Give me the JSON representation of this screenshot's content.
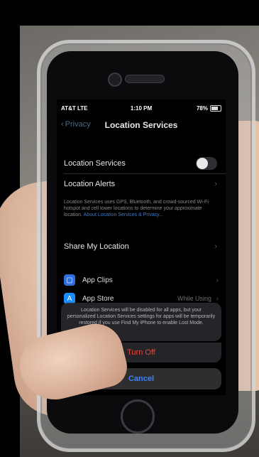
{
  "status_bar": {
    "carrier": "AT&T  LTE",
    "time": "1:10 PM",
    "battery": "78%"
  },
  "nav": {
    "back_label": "Privacy",
    "title": "Location Services"
  },
  "settings": {
    "location_services": "Location Services",
    "location_alerts": "Location Alerts",
    "description": "Location Services uses GPS, Bluetooth, and crowd-sourced Wi-Fi hotspot and cell tower locations to determine your approximate location.",
    "description_link": "About Location Services & Privacy...",
    "share_my_location": "Share My Location"
  },
  "apps": [
    {
      "name": "App Clips",
      "value": "",
      "color": "#2f6fe4"
    },
    {
      "name": "App Store",
      "value": "While Using",
      "color": "#1a8cff"
    }
  ],
  "alert": {
    "message": "Location Services will be disabled for all apps, but your personalized Location Services settings for apps will be temporarily restored if you use Find My iPhone to enable Lost Mode.",
    "turn_off_label": "Turn Off",
    "cancel_label": "Cancel"
  },
  "colors": {
    "link": "#3f78c4",
    "destructive": "#e5463b",
    "cancel": "#3b82f6"
  }
}
